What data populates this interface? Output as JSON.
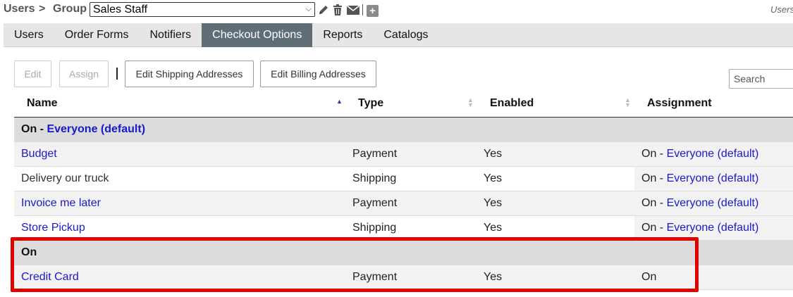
{
  "breadcrumb": {
    "users": "Users",
    "separator": ">",
    "group": "Group",
    "group_select_value": "Sales Staff",
    "right_label": "Users"
  },
  "tabs": [
    {
      "label": "Users"
    },
    {
      "label": "Order Forms"
    },
    {
      "label": "Notifiers"
    },
    {
      "label": "Checkout Options",
      "active": true
    },
    {
      "label": "Reports"
    },
    {
      "label": "Catalogs"
    }
  ],
  "actions": {
    "edit": "Edit",
    "assign": "Assign",
    "edit_shipping": "Edit Shipping Addresses",
    "edit_billing": "Edit Billing Addresses",
    "search_placeholder": "Search"
  },
  "table": {
    "headers": {
      "name": "Name",
      "type": "Type",
      "enabled": "Enabled",
      "assignment": "Assignment"
    },
    "groups": [
      {
        "label_prefix": "On - ",
        "label_link": "Everyone (default)",
        "rows": [
          {
            "name": "Budget",
            "type": "Payment",
            "enabled": "Yes",
            "assign_prefix": "On - ",
            "assign_link": "Everyone (default)"
          },
          {
            "name": "Delivery our truck",
            "type": "Shipping",
            "enabled": "Yes",
            "assign_prefix": "On - ",
            "assign_link": "Everyone (default)"
          },
          {
            "name": "Invoice me later",
            "type": "Payment",
            "enabled": "Yes",
            "assign_prefix": "On - ",
            "assign_link": "Everyone (default)"
          },
          {
            "name": "Store Pickup",
            "type": "Shipping",
            "enabled": "Yes",
            "assign_prefix": "On - ",
            "assign_link": "Everyone (default)"
          }
        ]
      },
      {
        "label_prefix": "On",
        "rows": [
          {
            "name": "Credit Card",
            "type": "Payment",
            "enabled": "Yes",
            "assign_prefix": "On"
          }
        ]
      }
    ]
  },
  "colors": {
    "active_tab": "#5f6d76",
    "link": "#1a1acc",
    "highlight": "#e00000"
  }
}
